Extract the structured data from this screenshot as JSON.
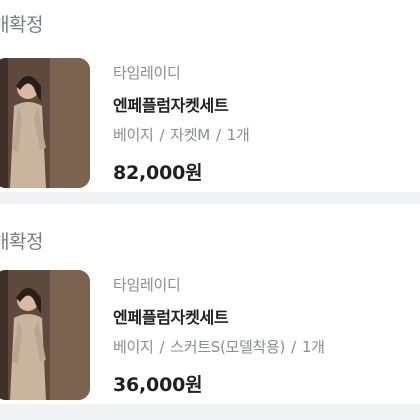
{
  "orders": [
    {
      "status": "배확정",
      "brand": "타임레이디",
      "product_name": "엔페플럼자켓세트",
      "option_color": "베이지",
      "option_item": "자켓M",
      "quantity": "1개",
      "price": "82,000원",
      "separator": "/"
    },
    {
      "status": "배확정",
      "brand": "타임레이디",
      "product_name": "엔페플럼자켓세트",
      "option_color": "베이지",
      "option_item": "스커트S(모델착용)",
      "quantity": "1개",
      "price": "36,000원",
      "separator": "/"
    }
  ]
}
